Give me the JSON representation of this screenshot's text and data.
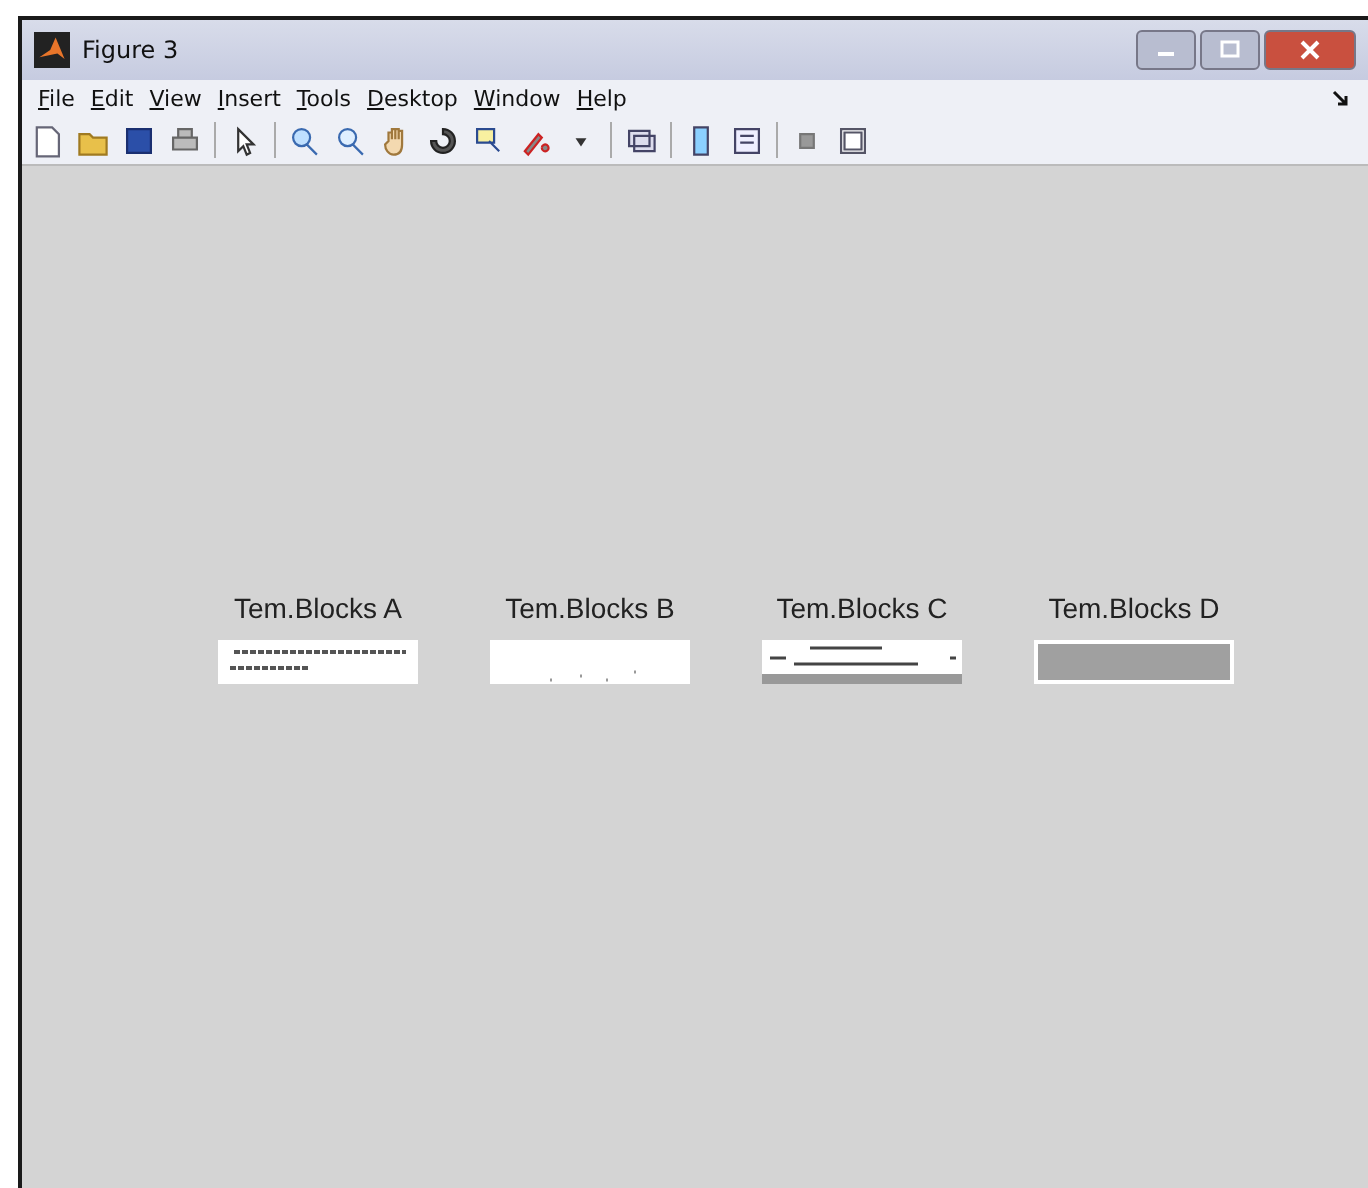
{
  "window": {
    "title": "Figure 3"
  },
  "menu": [
    "File",
    "Edit",
    "View",
    "Insert",
    "Tools",
    "Desktop",
    "Window",
    "Help"
  ],
  "blocks": [
    {
      "label": "Tem.Blocks A",
      "kind": "text"
    },
    {
      "label": "Tem.Blocks B",
      "kind": "blank"
    },
    {
      "label": "Tem.Blocks C",
      "kind": "slider"
    },
    {
      "label": "Tem.Blocks D",
      "kind": "gray"
    }
  ]
}
